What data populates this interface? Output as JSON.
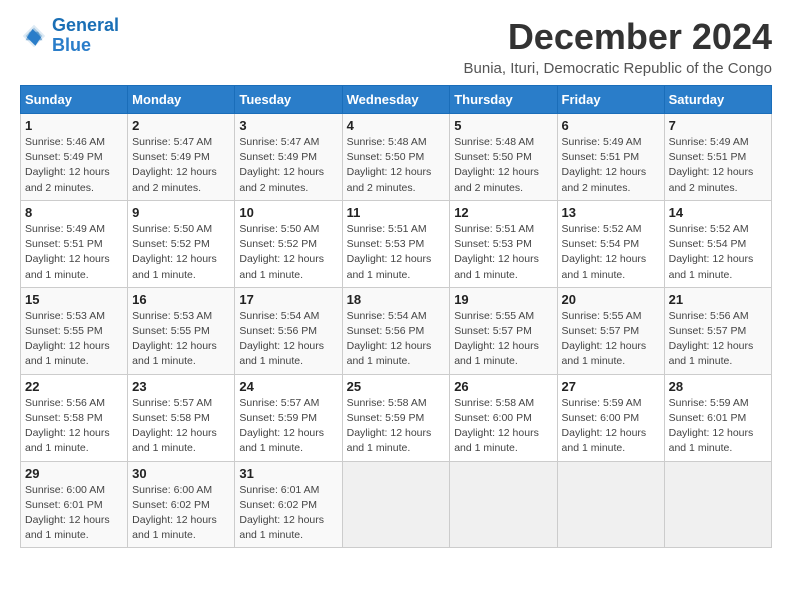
{
  "logo": {
    "text_general": "General",
    "text_blue": "Blue"
  },
  "title": "December 2024",
  "subtitle": "Bunia, Ituri, Democratic Republic of the Congo",
  "days_of_week": [
    "Sunday",
    "Monday",
    "Tuesday",
    "Wednesday",
    "Thursday",
    "Friday",
    "Saturday"
  ],
  "weeks": [
    [
      {
        "day": "1",
        "info": "Sunrise: 5:46 AM\nSunset: 5:49 PM\nDaylight: 12 hours and 2 minutes."
      },
      {
        "day": "2",
        "info": "Sunrise: 5:47 AM\nSunset: 5:49 PM\nDaylight: 12 hours and 2 minutes."
      },
      {
        "day": "3",
        "info": "Sunrise: 5:47 AM\nSunset: 5:49 PM\nDaylight: 12 hours and 2 minutes."
      },
      {
        "day": "4",
        "info": "Sunrise: 5:48 AM\nSunset: 5:50 PM\nDaylight: 12 hours and 2 minutes."
      },
      {
        "day": "5",
        "info": "Sunrise: 5:48 AM\nSunset: 5:50 PM\nDaylight: 12 hours and 2 minutes."
      },
      {
        "day": "6",
        "info": "Sunrise: 5:49 AM\nSunset: 5:51 PM\nDaylight: 12 hours and 2 minutes."
      },
      {
        "day": "7",
        "info": "Sunrise: 5:49 AM\nSunset: 5:51 PM\nDaylight: 12 hours and 2 minutes."
      }
    ],
    [
      {
        "day": "8",
        "info": "Sunrise: 5:49 AM\nSunset: 5:51 PM\nDaylight: 12 hours and 1 minute."
      },
      {
        "day": "9",
        "info": "Sunrise: 5:50 AM\nSunset: 5:52 PM\nDaylight: 12 hours and 1 minute."
      },
      {
        "day": "10",
        "info": "Sunrise: 5:50 AM\nSunset: 5:52 PM\nDaylight: 12 hours and 1 minute."
      },
      {
        "day": "11",
        "info": "Sunrise: 5:51 AM\nSunset: 5:53 PM\nDaylight: 12 hours and 1 minute."
      },
      {
        "day": "12",
        "info": "Sunrise: 5:51 AM\nSunset: 5:53 PM\nDaylight: 12 hours and 1 minute."
      },
      {
        "day": "13",
        "info": "Sunrise: 5:52 AM\nSunset: 5:54 PM\nDaylight: 12 hours and 1 minute."
      },
      {
        "day": "14",
        "info": "Sunrise: 5:52 AM\nSunset: 5:54 PM\nDaylight: 12 hours and 1 minute."
      }
    ],
    [
      {
        "day": "15",
        "info": "Sunrise: 5:53 AM\nSunset: 5:55 PM\nDaylight: 12 hours and 1 minute."
      },
      {
        "day": "16",
        "info": "Sunrise: 5:53 AM\nSunset: 5:55 PM\nDaylight: 12 hours and 1 minute."
      },
      {
        "day": "17",
        "info": "Sunrise: 5:54 AM\nSunset: 5:56 PM\nDaylight: 12 hours and 1 minute."
      },
      {
        "day": "18",
        "info": "Sunrise: 5:54 AM\nSunset: 5:56 PM\nDaylight: 12 hours and 1 minute."
      },
      {
        "day": "19",
        "info": "Sunrise: 5:55 AM\nSunset: 5:57 PM\nDaylight: 12 hours and 1 minute."
      },
      {
        "day": "20",
        "info": "Sunrise: 5:55 AM\nSunset: 5:57 PM\nDaylight: 12 hours and 1 minute."
      },
      {
        "day": "21",
        "info": "Sunrise: 5:56 AM\nSunset: 5:57 PM\nDaylight: 12 hours and 1 minute."
      }
    ],
    [
      {
        "day": "22",
        "info": "Sunrise: 5:56 AM\nSunset: 5:58 PM\nDaylight: 12 hours and 1 minute."
      },
      {
        "day": "23",
        "info": "Sunrise: 5:57 AM\nSunset: 5:58 PM\nDaylight: 12 hours and 1 minute."
      },
      {
        "day": "24",
        "info": "Sunrise: 5:57 AM\nSunset: 5:59 PM\nDaylight: 12 hours and 1 minute."
      },
      {
        "day": "25",
        "info": "Sunrise: 5:58 AM\nSunset: 5:59 PM\nDaylight: 12 hours and 1 minute."
      },
      {
        "day": "26",
        "info": "Sunrise: 5:58 AM\nSunset: 6:00 PM\nDaylight: 12 hours and 1 minute."
      },
      {
        "day": "27",
        "info": "Sunrise: 5:59 AM\nSunset: 6:00 PM\nDaylight: 12 hours and 1 minute."
      },
      {
        "day": "28",
        "info": "Sunrise: 5:59 AM\nSunset: 6:01 PM\nDaylight: 12 hours and 1 minute."
      }
    ],
    [
      {
        "day": "29",
        "info": "Sunrise: 6:00 AM\nSunset: 6:01 PM\nDaylight: 12 hours and 1 minute."
      },
      {
        "day": "30",
        "info": "Sunrise: 6:00 AM\nSunset: 6:02 PM\nDaylight: 12 hours and 1 minute."
      },
      {
        "day": "31",
        "info": "Sunrise: 6:01 AM\nSunset: 6:02 PM\nDaylight: 12 hours and 1 minute."
      },
      {
        "day": "",
        "info": ""
      },
      {
        "day": "",
        "info": ""
      },
      {
        "day": "",
        "info": ""
      },
      {
        "day": "",
        "info": ""
      }
    ]
  ]
}
